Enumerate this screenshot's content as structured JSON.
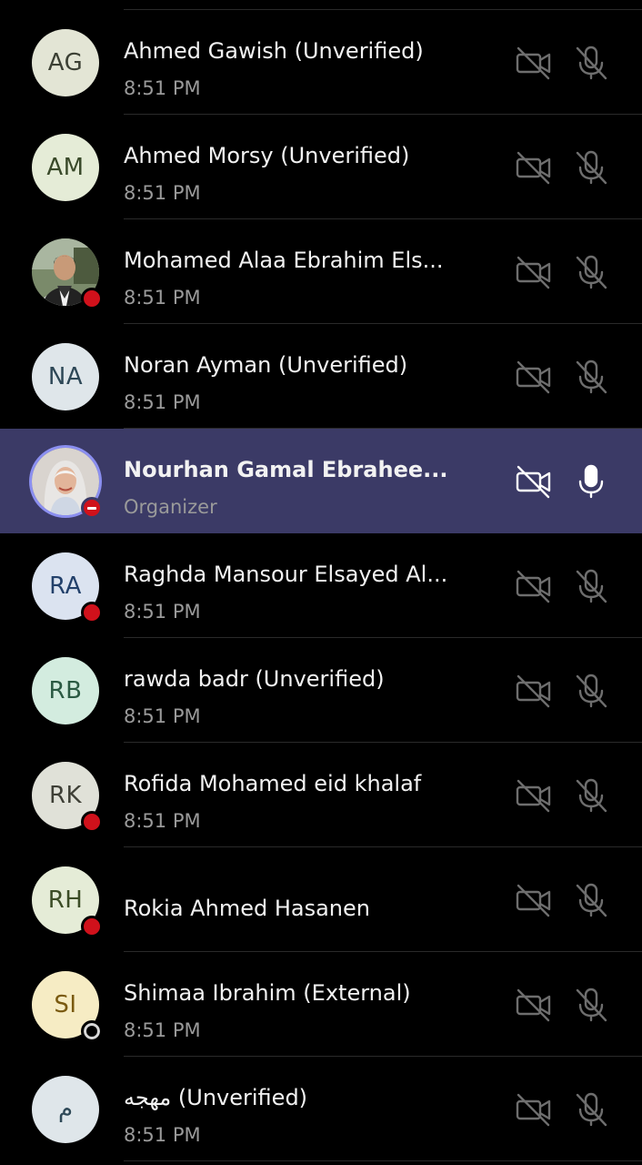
{
  "participants": [
    {
      "initials": "",
      "name": "",
      "sub": "",
      "avatar_bg": "#000000",
      "avatar_fg": "#000000",
      "hidden": true
    },
    {
      "initials": "AG",
      "name": "Ahmed Gawish (Unverified)",
      "sub": "8:51 PM",
      "avatar_bg": "#e3e5d5",
      "avatar_fg": "#3c4034",
      "status": "none",
      "mic": "muted"
    },
    {
      "initials": "AM",
      "name": "Ahmed Morsy (Unverified)",
      "sub": "8:51 PM",
      "avatar_bg": "#e5ecd7",
      "avatar_fg": "#3a4a2a",
      "status": "none",
      "mic": "muted"
    },
    {
      "initials": "",
      "name": "Mohamed  Alaa Ebrahim Els...",
      "sub": "8:51 PM",
      "avatar_bg": "#555555",
      "avatar_fg": "#ffffff",
      "status": "busy",
      "mic": "muted",
      "photo": "man-photo-icon"
    },
    {
      "initials": "NA",
      "name": "Noran Ayman (Unverified)",
      "sub": "8:51 PM",
      "avatar_bg": "#dfe6ea",
      "avatar_fg": "#2e4857",
      "status": "none",
      "mic": "muted"
    },
    {
      "initials": "",
      "name": "Nourhan Gamal Ebrahee...",
      "sub": "Organizer",
      "avatar_bg": "#cccccc",
      "avatar_fg": "#ffffff",
      "status": "dnd",
      "mic": "on",
      "photo": "woman-photo-icon",
      "highlight": true
    },
    {
      "initials": "RA",
      "name": "Raghda Mansour Elsayed Al...",
      "sub": "8:51 PM",
      "avatar_bg": "#dbe3f0",
      "avatar_fg": "#23416b",
      "status": "busy",
      "mic": "muted"
    },
    {
      "initials": "RB",
      "name": "rawda badr (Unverified)",
      "sub": "8:51 PM",
      "avatar_bg": "#d3ecdf",
      "avatar_fg": "#2b5a43",
      "status": "none",
      "mic": "muted"
    },
    {
      "initials": "RK",
      "name": "Rofida Mohamed eid  khalaf",
      "sub": "8:51 PM",
      "avatar_bg": "#e0e1d8",
      "avatar_fg": "#3e3f36",
      "status": "busy",
      "mic": "muted"
    },
    {
      "initials": "RH",
      "name": "Rokia Ahmed Hasanen",
      "sub": "",
      "avatar_bg": "#e5ecd7",
      "avatar_fg": "#3c4d26",
      "status": "busy",
      "mic": "muted"
    },
    {
      "initials": "SI",
      "name": "Shimaa Ibrahim (External)",
      "sub": "8:51 PM",
      "avatar_bg": "#f6ecc4",
      "avatar_fg": "#7a5a10",
      "status": "offline",
      "mic": "muted"
    },
    {
      "initials": "م",
      "name": "مهجه (Unverified)",
      "sub": "8:51 PM",
      "avatar_bg": "#dfe6ea",
      "avatar_fg": "#2e4857",
      "status": "none",
      "mic": "muted"
    }
  ],
  "colors": {
    "background": "#000000",
    "highlight": "#3b3a66",
    "busy_status": "#d0111b",
    "muted_icon": "#6e6e6e",
    "active_icon": "#ffffff"
  },
  "icons": {
    "camera": "video-off-icon",
    "mic_muted": "mic-off-icon",
    "mic_on": "mic-icon"
  }
}
